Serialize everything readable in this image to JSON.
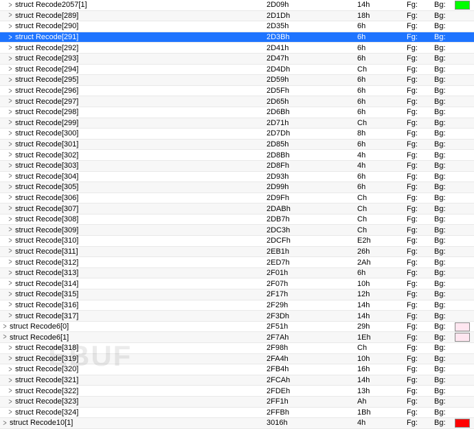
{
  "watermark": "EBUF",
  "fg_label": "Fg:",
  "bg_label": "Bg:",
  "rows": [
    {
      "name": "struct Recode2057[1]",
      "addr": "2D09h",
      "size": "14h",
      "swatch": "green",
      "indent": 1
    },
    {
      "name": "struct Recode[289]",
      "addr": "2D1Dh",
      "size": "18h",
      "swatch": null,
      "indent": 1
    },
    {
      "name": "struct Recode[290]",
      "addr": "2D35h",
      "size": "6h",
      "swatch": null,
      "indent": 1
    },
    {
      "name": "struct Recode[291]",
      "addr": "2D3Bh",
      "size": "6h",
      "swatch": null,
      "indent": 1,
      "selected": true
    },
    {
      "name": "struct Recode[292]",
      "addr": "2D41h",
      "size": "6h",
      "swatch": null,
      "indent": 1
    },
    {
      "name": "struct Recode[293]",
      "addr": "2D47h",
      "size": "6h",
      "swatch": null,
      "indent": 1
    },
    {
      "name": "struct Recode[294]",
      "addr": "2D4Dh",
      "size": "Ch",
      "swatch": null,
      "indent": 1
    },
    {
      "name": "struct Recode[295]",
      "addr": "2D59h",
      "size": "6h",
      "swatch": null,
      "indent": 1
    },
    {
      "name": "struct Recode[296]",
      "addr": "2D5Fh",
      "size": "6h",
      "swatch": null,
      "indent": 1
    },
    {
      "name": "struct Recode[297]",
      "addr": "2D65h",
      "size": "6h",
      "swatch": null,
      "indent": 1
    },
    {
      "name": "struct Recode[298]",
      "addr": "2D6Bh",
      "size": "6h",
      "swatch": null,
      "indent": 1
    },
    {
      "name": "struct Recode[299]",
      "addr": "2D71h",
      "size": "Ch",
      "swatch": null,
      "indent": 1
    },
    {
      "name": "struct Recode[300]",
      "addr": "2D7Dh",
      "size": "8h",
      "swatch": null,
      "indent": 1
    },
    {
      "name": "struct Recode[301]",
      "addr": "2D85h",
      "size": "6h",
      "swatch": null,
      "indent": 1
    },
    {
      "name": "struct Recode[302]",
      "addr": "2D8Bh",
      "size": "4h",
      "swatch": null,
      "indent": 1
    },
    {
      "name": "struct Recode[303]",
      "addr": "2D8Fh",
      "size": "4h",
      "swatch": null,
      "indent": 1
    },
    {
      "name": "struct Recode[304]",
      "addr": "2D93h",
      "size": "6h",
      "swatch": null,
      "indent": 1
    },
    {
      "name": "struct Recode[305]",
      "addr": "2D99h",
      "size": "6h",
      "swatch": null,
      "indent": 1
    },
    {
      "name": "struct Recode[306]",
      "addr": "2D9Fh",
      "size": "Ch",
      "swatch": null,
      "indent": 1
    },
    {
      "name": "struct Recode[307]",
      "addr": "2DABh",
      "size": "Ch",
      "swatch": null,
      "indent": 1
    },
    {
      "name": "struct Recode[308]",
      "addr": "2DB7h",
      "size": "Ch",
      "swatch": null,
      "indent": 1
    },
    {
      "name": "struct Recode[309]",
      "addr": "2DC3h",
      "size": "Ch",
      "swatch": null,
      "indent": 1
    },
    {
      "name": "struct Recode[310]",
      "addr": "2DCFh",
      "size": "E2h",
      "swatch": null,
      "indent": 1
    },
    {
      "name": "struct Recode[311]",
      "addr": "2EB1h",
      "size": "26h",
      "swatch": null,
      "indent": 1
    },
    {
      "name": "struct Recode[312]",
      "addr": "2ED7h",
      "size": "2Ah",
      "swatch": null,
      "indent": 1
    },
    {
      "name": "struct Recode[313]",
      "addr": "2F01h",
      "size": "6h",
      "swatch": null,
      "indent": 1
    },
    {
      "name": "struct Recode[314]",
      "addr": "2F07h",
      "size": "10h",
      "swatch": null,
      "indent": 1
    },
    {
      "name": "struct Recode[315]",
      "addr": "2F17h",
      "size": "12h",
      "swatch": null,
      "indent": 1
    },
    {
      "name": "struct Recode[316]",
      "addr": "2F29h",
      "size": "14h",
      "swatch": null,
      "indent": 1
    },
    {
      "name": "struct Recode[317]",
      "addr": "2F3Dh",
      "size": "14h",
      "swatch": null,
      "indent": 1
    },
    {
      "name": "struct Recode6[0]",
      "addr": "2F51h",
      "size": "29h",
      "swatch": "pink",
      "indent": 0
    },
    {
      "name": "struct Recode6[1]",
      "addr": "2F7Ah",
      "size": "1Eh",
      "swatch": "pink",
      "indent": 0
    },
    {
      "name": "struct Recode[318]",
      "addr": "2F98h",
      "size": "Ch",
      "swatch": null,
      "indent": 1
    },
    {
      "name": "struct Recode[319]",
      "addr": "2FA4h",
      "size": "10h",
      "swatch": null,
      "indent": 1
    },
    {
      "name": "struct Recode[320]",
      "addr": "2FB4h",
      "size": "16h",
      "swatch": null,
      "indent": 1
    },
    {
      "name": "struct Recode[321]",
      "addr": "2FCAh",
      "size": "14h",
      "swatch": null,
      "indent": 1
    },
    {
      "name": "struct Recode[322]",
      "addr": "2FDEh",
      "size": "13h",
      "swatch": null,
      "indent": 1
    },
    {
      "name": "struct Recode[323]",
      "addr": "2FF1h",
      "size": "Ah",
      "swatch": null,
      "indent": 1
    },
    {
      "name": "struct Recode[324]",
      "addr": "2FFBh",
      "size": "1Bh",
      "swatch": null,
      "indent": 1
    },
    {
      "name": "struct Recode10[1]",
      "addr": "3016h",
      "size": "4h",
      "swatch": "red",
      "indent": 0
    }
  ]
}
